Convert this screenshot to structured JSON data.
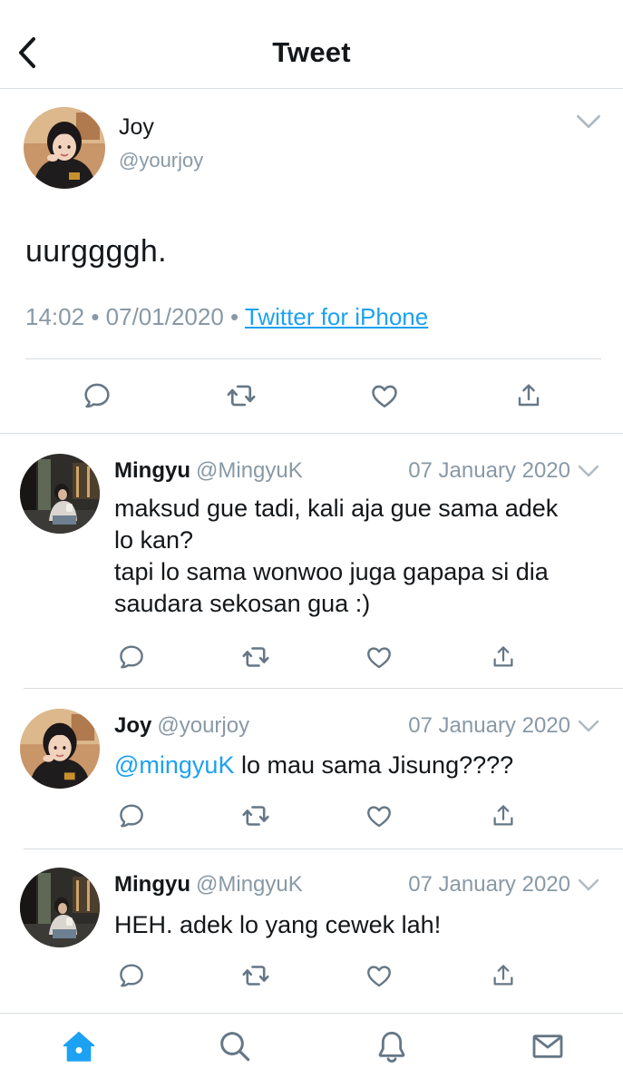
{
  "header": {
    "title": "Tweet",
    "back_icon": "chevron-left-icon"
  },
  "main_tweet": {
    "author_name": "Joy",
    "author_handle": "@yourjoy",
    "text": "uurggggh.",
    "time": "14:02",
    "date": "07/01/2020",
    "source": "Twitter for iPhone",
    "bullet": "•"
  },
  "replies": [
    {
      "name": "Mingyu",
      "handle": "@MingyuK",
      "date": "07 January 2020",
      "lines": [
        "maksud gue tadi, kali aja gue sama adek",
        "lo kan?",
        "tapi lo sama wonwoo juga gapapa si dia",
        "saudara sekosan gua :)"
      ]
    },
    {
      "name": "Joy",
      "handle": "@yourjoy",
      "date": "07 January 2020",
      "mention": "@mingyuK",
      "text": " lo mau sama Jisung????"
    },
    {
      "name": "Mingyu",
      "handle": "@MingyuK",
      "date": "07 January 2020",
      "text": "HEH. adek lo yang cewek lah!"
    }
  ],
  "colors": {
    "accent": "#1da1f2",
    "muted": "#8899a6",
    "icon": "#657786",
    "text": "#14171a",
    "divider": "#d8dde2"
  },
  "tabs": [
    {
      "icon": "home-icon",
      "active": true
    },
    {
      "icon": "search-icon",
      "active": false
    },
    {
      "icon": "bell-icon",
      "active": false
    },
    {
      "icon": "mail-icon",
      "active": false
    }
  ]
}
